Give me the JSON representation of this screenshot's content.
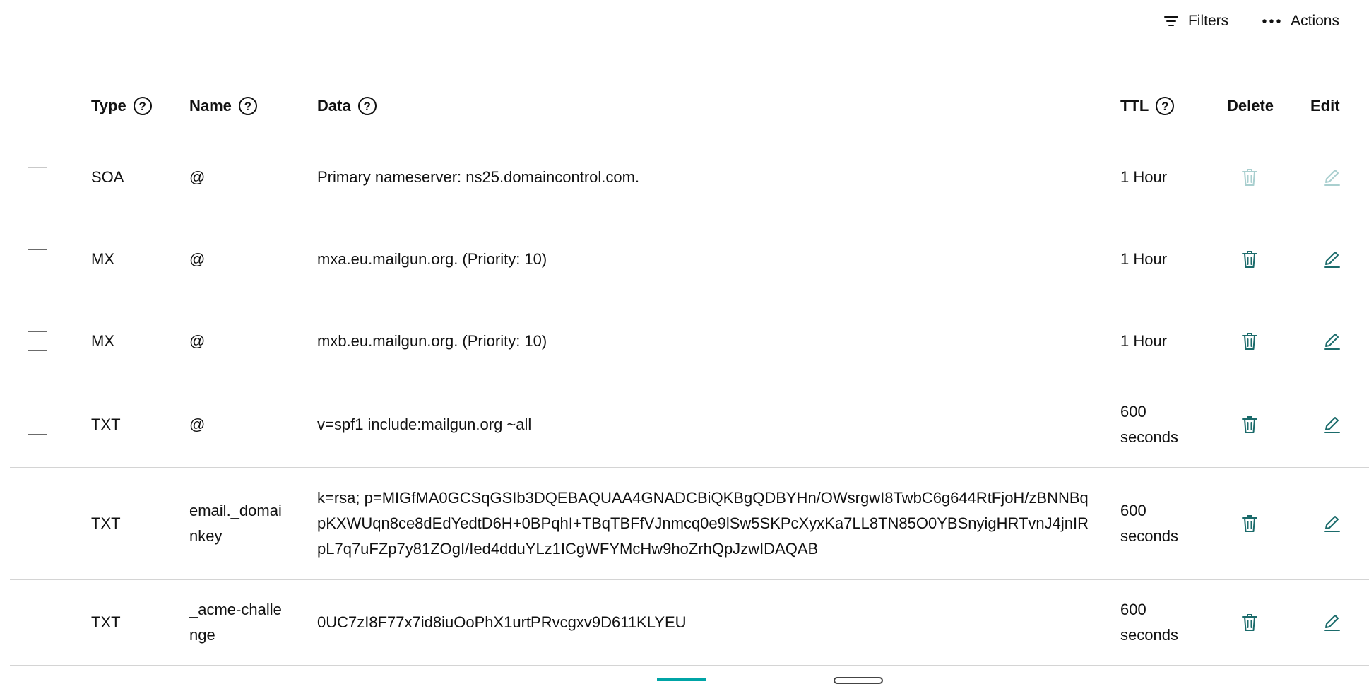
{
  "toolbar": {
    "filters_label": "Filters",
    "actions_label": "Actions"
  },
  "columns": {
    "type": "Type",
    "name": "Name",
    "data": "Data",
    "ttl": "TTL",
    "delete": "Delete",
    "edit": "Edit",
    "help_glyph": "?"
  },
  "records": [
    {
      "type": "SOA",
      "name": "@",
      "data": "Primary nameserver: ns25.domaincontrol.com.",
      "ttl": "1 Hour",
      "editable": false
    },
    {
      "type": "MX",
      "name": "@",
      "data": "mxa.eu.mailgun.org. (Priority: 10)",
      "ttl": "1 Hour",
      "editable": true
    },
    {
      "type": "MX",
      "name": "@",
      "data": "mxb.eu.mailgun.org. (Priority: 10)",
      "ttl": "1 Hour",
      "editable": true
    },
    {
      "type": "TXT",
      "name": "@",
      "data": "v=spf1 include:mailgun.org ~all",
      "ttl": "600 seconds",
      "editable": true
    },
    {
      "type": "TXT",
      "name": "email._domainkey",
      "data": "k=rsa; p=MIGfMA0GCSqGSIb3DQEBAQUAA4GNADCBiQKBgQDBYHn/OWsrgwI8TwbC6g644RtFjoH/zBNNBqpKXWUqn8ce8dEdYedtD6H+0BPqhI+TBqTBFfVJnmcq0e9lSw5SKPcXyxKa7LL8TN85O0YBSnyigHRTvnJ4jnIRpL7q7uFZp7y81ZOgI/Ied4dduYLz1ICgWFYMcHw9hoZrhQpJzwIDAQAB",
      "ttl": "600 seconds",
      "editable": true
    },
    {
      "type": "TXT",
      "name": "_acme-challenge",
      "data": "0UC7zI8F77x7id8iuOoPhX1urtPRvcgxv9D611KLYEU",
      "ttl": "600 seconds",
      "editable": true
    }
  ],
  "colors": {
    "accent": "#1b6b6b",
    "accent_disabled": "#a9cfcf",
    "divider": "#d4d4d4",
    "pager_accent": "#00a4a6"
  },
  "icons": {
    "filters": "filter-lines-icon",
    "actions": "more-dots-icon",
    "delete": "trash-icon",
    "edit": "pencil-icon",
    "help": "question-circle-icon"
  }
}
